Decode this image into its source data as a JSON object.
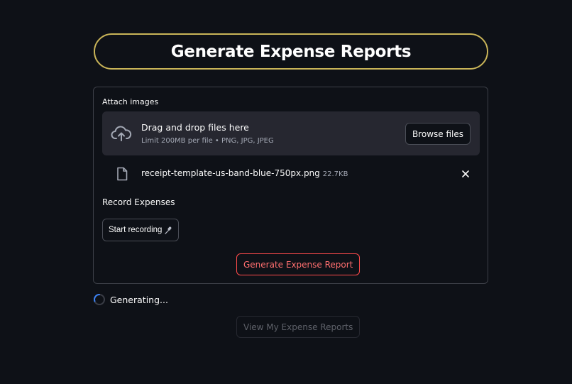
{
  "title": "Generate Expense Reports",
  "uploader": {
    "label": "Attach images",
    "drop_title": "Drag and drop files here",
    "drop_subtitle": "Limit 200MB per file • PNG, JPG, JPEG",
    "browse_label": "Browse files",
    "icon": "cloud-upload-icon"
  },
  "file": {
    "name": "receipt-template-us-band-blue-750px.png",
    "size": "22.7KB",
    "icon": "file-icon",
    "remove_icon": "close-icon"
  },
  "recorder": {
    "label": "Record Expenses",
    "button_label": "Start recording",
    "icon": "microphone-icon"
  },
  "actions": {
    "generate_label": "Generate Expense Report",
    "view_label": "View My Expense Reports"
  },
  "status": {
    "text": "Generating..."
  },
  "colors": {
    "background": "#0e1117",
    "title_border": "#c9b458",
    "primary": "#ff4b4b",
    "spinner": "#3b82f6"
  }
}
